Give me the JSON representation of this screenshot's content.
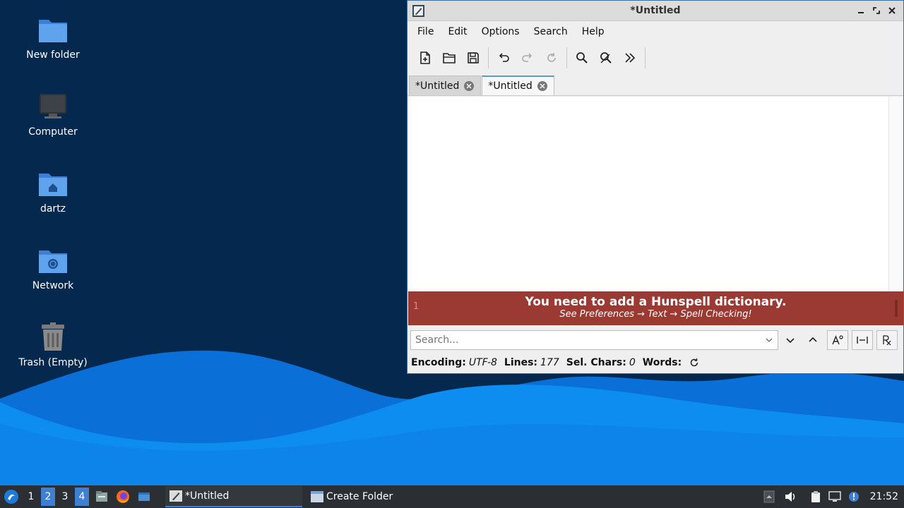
{
  "desktop": {
    "icons": [
      {
        "label": "New folder"
      },
      {
        "label": "Computer"
      },
      {
        "label": "dartz"
      },
      {
        "label": "Network"
      },
      {
        "label": "Trash (Empty)"
      }
    ]
  },
  "window": {
    "title": "*Untitled",
    "menu": [
      "File",
      "Edit",
      "Options",
      "Search",
      "Help"
    ],
    "toolbar_icons": [
      "new-document-icon",
      "open-folder-icon",
      "save-icon",
      "undo-icon",
      "redo-icon",
      "reload-icon",
      "find-icon",
      "find-replace-icon",
      "more-chevrons-icon"
    ],
    "tabs": [
      {
        "label": "*Untitled",
        "active": false
      },
      {
        "label": "*Untitled",
        "active": true
      }
    ],
    "banner": {
      "line_number": "1",
      "heading": "You need to add a Hunspell dictionary.",
      "subtext": "See Preferences → Text → Spell Checking!",
      "color": "#9b3a32"
    },
    "search": {
      "placeholder": "Search..."
    },
    "status": {
      "encoding_label": "Encoding:",
      "encoding_value": "UTF-8",
      "lines_label": "Lines:",
      "lines_value": "177",
      "sel_label": "Sel. Chars:",
      "sel_value": "0",
      "words_label": "Words:"
    }
  },
  "taskbar": {
    "workspaces": [
      "1",
      "2",
      "3",
      "4"
    ],
    "active_workspaces": [
      "2",
      "4"
    ],
    "tasks": [
      {
        "label": "*Untitled",
        "active": true
      },
      {
        "label": "Create Folder",
        "active": false
      }
    ],
    "clock": "21:52",
    "accent": "#3d7fd1"
  }
}
